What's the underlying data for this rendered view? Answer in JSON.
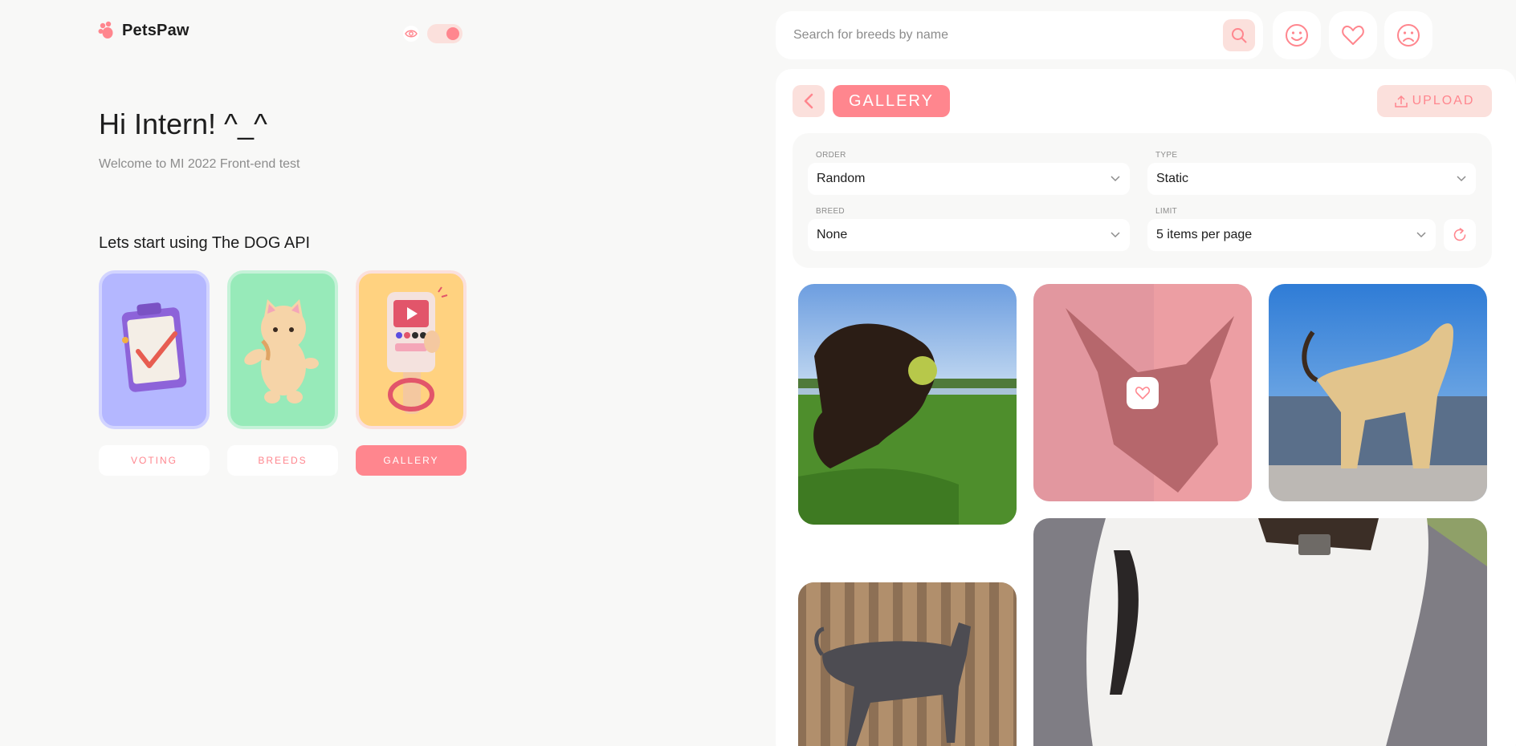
{
  "app": {
    "logo_text": "PetsPaw",
    "accent_color": "#FF868E",
    "accent_light": "#FBE0DC"
  },
  "intro": {
    "greeting": "Hi Intern! ^_^",
    "welcome": "Welcome to MI 2022 Front-end test",
    "start_text": "Lets start using The DOG API"
  },
  "nav": {
    "cards": [
      {
        "label": "VOTING",
        "color": "#B4B7FF",
        "border": "#D2D4FF",
        "icon": "clipboard-illustration"
      },
      {
        "label": "BREEDS",
        "color": "#97EAB9",
        "border": "#C5F2D8",
        "icon": "cat-illustration"
      },
      {
        "label": "GALLERY",
        "color": "#FFD280",
        "border": "#FBE0DC",
        "icon": "phone-illustration",
        "active": true
      }
    ]
  },
  "search": {
    "placeholder": "Search for breeds by name"
  },
  "top_icons": [
    "smile-icon",
    "heart-icon",
    "sad-icon"
  ],
  "gallery_page": {
    "title": "GALLERY",
    "upload_label": "UPLOAD",
    "filters": {
      "order": {
        "label": "ORDER",
        "value": "Random"
      },
      "type": {
        "label": "TYPE",
        "value": "Static"
      },
      "breed": {
        "label": "BREED",
        "value": "None"
      },
      "limit": {
        "label": "LIMIT",
        "value": "5 items per page"
      }
    },
    "photos": [
      {
        "subject": "brown dog with tennis ball"
      },
      {
        "subject": "dark short-haired dog",
        "hovered": true
      },
      {
        "subject": "long-haired afghan hound"
      },
      {
        "subject": "grey greyhound by fence"
      },
      {
        "subject": "white dog with collar"
      }
    ]
  }
}
